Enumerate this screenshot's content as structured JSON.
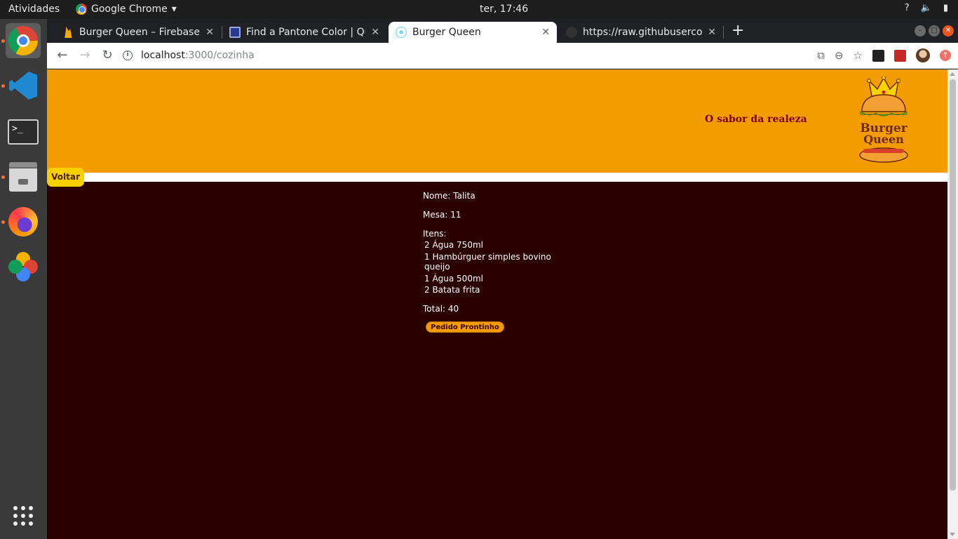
{
  "system": {
    "activities": "Atividades",
    "app_name": "Google Chrome",
    "clock": "ter, 17:46",
    "tray": [
      "?",
      "🔈",
      "▮"
    ]
  },
  "browser": {
    "tabs": [
      {
        "title": "Burger Queen – Firebase c",
        "favicon": "firebase-icon",
        "color": "#f6a800"
      },
      {
        "title": "Find a Pantone Color | Qu",
        "favicon": "pantone-icon",
        "color": "#2a3a8c"
      },
      {
        "title": "Burger Queen",
        "favicon": "react-icon",
        "color": "#61dafb"
      },
      {
        "title": "https://raw.githubuserco",
        "favicon": "github-icon",
        "color": "#333333"
      }
    ],
    "active_tab": 2,
    "url_host": "localhost",
    "url_path": ":3000/cozinha"
  },
  "page": {
    "slogan": "O sabor da realeza",
    "logo_text_1": "Burger",
    "logo_text_2": "Queen",
    "back_label": "Voltar",
    "order": {
      "name": "Nome: Talita",
      "table": "Mesa: 11",
      "items_label": "Itens:",
      "items": [
        "2 Água 750ml",
        "1 Hambúrguer simples bovino queijo",
        "1 Água 500ml",
        "2 Batata frita"
      ],
      "total": "Total: 40",
      "ready_label": "Pedido Prontinho"
    }
  },
  "colors": {
    "header_orange": "#f39c00",
    "page_bg": "#2a0000",
    "back_button_yellow": "#f6d000"
  }
}
